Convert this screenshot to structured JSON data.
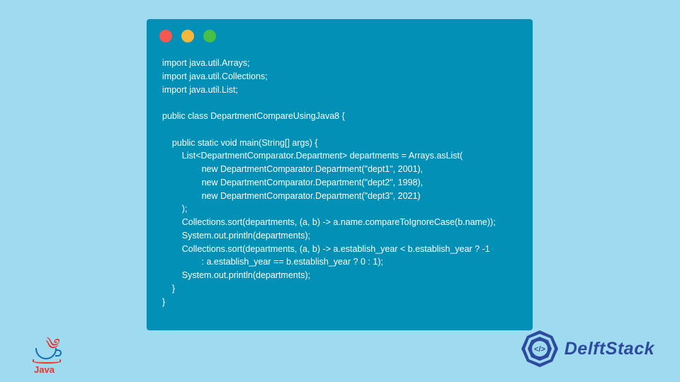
{
  "code": {
    "lines": [
      "import java.util.Arrays;",
      "import java.util.Collections;",
      "import java.util.List;",
      "",
      "public class DepartmentCompareUsingJava8 {",
      "",
      "    public static void main(String[] args) {",
      "        List<DepartmentComparator.Department> departments = Arrays.asList(",
      "                new DepartmentComparator.Department(\"dept1\", 2001),",
      "                new DepartmentComparator.Department(\"dept2\", 1998),",
      "                new DepartmentComparator.Department(\"dept3\", 2021)",
      "        );",
      "        Collections.sort(departments, (a, b) -> a.name.compareToIgnoreCase(b.name));",
      "        System.out.println(departments);",
      "        Collections.sort(departments, (a, b) -> a.establish_year < b.establish_year ? -1",
      "                : a.establish_year == b.establish_year ? 0 : 1);",
      "        System.out.println(departments);",
      "    }",
      "}"
    ]
  },
  "logos": {
    "java": {
      "text": "Java",
      "steam": "༄"
    },
    "delft": {
      "text": "DelftStack"
    }
  }
}
